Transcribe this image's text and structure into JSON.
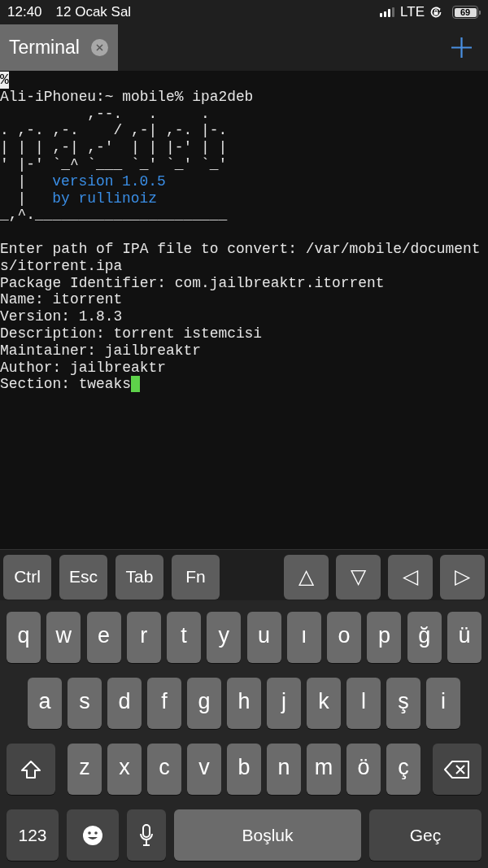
{
  "status_bar": {
    "time": "12:40",
    "date": "12 Ocak Sal",
    "network": "LTE",
    "battery": "69"
  },
  "tabs": [
    {
      "label": "Terminal",
      "selected": true
    }
  ],
  "terminal": {
    "lines": [
      {
        "kind": "marker",
        "segments": [
          {
            "text": "%",
            "accent": false
          }
        ]
      },
      {
        "kind": "text",
        "segments": [
          {
            "text": "Ali-iPhoneu:~ mobile% ipa2deb",
            "accent": false
          }
        ]
      },
      {
        "kind": "text",
        "segments": [
          {
            "text": "          ,--.   .     .",
            "accent": false
          }
        ]
      },
      {
        "kind": "text",
        "segments": [
          {
            "text": ". ,-. ,-.    / ,-| ,-. |-.",
            "accent": false
          }
        ]
      },
      {
        "kind": "text",
        "segments": [
          {
            "text": "| | | ,-| ,-'  | | |-' | |",
            "accent": false
          }
        ]
      },
      {
        "kind": "text",
        "segments": [
          {
            "text": "' |-' `_^ `___ `_' `_' `_'",
            "accent": false
          }
        ]
      },
      {
        "kind": "text",
        "segments": [
          {
            "text": "  |",
            "accent": false
          },
          {
            "text": "version 1.0.5",
            "accent": true
          }
        ]
      },
      {
        "kind": "text",
        "segments": [
          {
            "text": "  |",
            "accent": false
          },
          {
            "text": "by rullinoiz",
            "accent": true
          }
        ]
      },
      {
        "kind": "text",
        "segments": [
          {
            "text": "_,^.______________________",
            "accent": false
          }
        ]
      },
      {
        "kind": "blank"
      },
      {
        "kind": "text",
        "segments": [
          {
            "text": "Enter path of IPA file to convert: /var/mobile/document",
            "accent": false
          }
        ]
      },
      {
        "kind": "text",
        "segments": [
          {
            "text": "s/itorrent.ipa",
            "accent": false
          }
        ]
      },
      {
        "kind": "text",
        "segments": [
          {
            "text": "Package Identifier: com.jailbreaktr.itorrent",
            "accent": false
          }
        ]
      },
      {
        "kind": "text",
        "segments": [
          {
            "text": "Name: itorrent",
            "accent": false
          }
        ]
      },
      {
        "kind": "text",
        "segments": [
          {
            "text": "Version: 1.8.3",
            "accent": false
          }
        ]
      },
      {
        "kind": "text",
        "segments": [
          {
            "text": "Description: torrent istemcisi",
            "accent": false
          }
        ]
      },
      {
        "kind": "text",
        "segments": [
          {
            "text": "Maintainer: jailbreaktr",
            "accent": false
          }
        ]
      },
      {
        "kind": "text",
        "segments": [
          {
            "text": "Author: jailbreaktr",
            "accent": false
          }
        ]
      },
      {
        "kind": "prompt",
        "segments": [
          {
            "text": "Section: tweaks",
            "accent": false
          }
        ],
        "cursor": true
      }
    ]
  },
  "accessory_keys": {
    "left": [
      "Ctrl",
      "Esc",
      "Tab",
      "Fn"
    ],
    "right": [
      "△",
      "▽",
      "◁",
      "▷"
    ]
  },
  "keyboard": {
    "rows": [
      [
        "q",
        "w",
        "e",
        "r",
        "t",
        "y",
        "u",
        "ı",
        "o",
        "p",
        "ğ",
        "ü"
      ],
      [
        "a",
        "s",
        "d",
        "f",
        "g",
        "h",
        "j",
        "k",
        "l",
        "ş",
        "i"
      ],
      [
        "z",
        "x",
        "c",
        "v",
        "b",
        "n",
        "m",
        "ö",
        "ç"
      ]
    ],
    "bottom": {
      "numbers": "123",
      "space": "Boşluk",
      "return": "Geç"
    }
  }
}
